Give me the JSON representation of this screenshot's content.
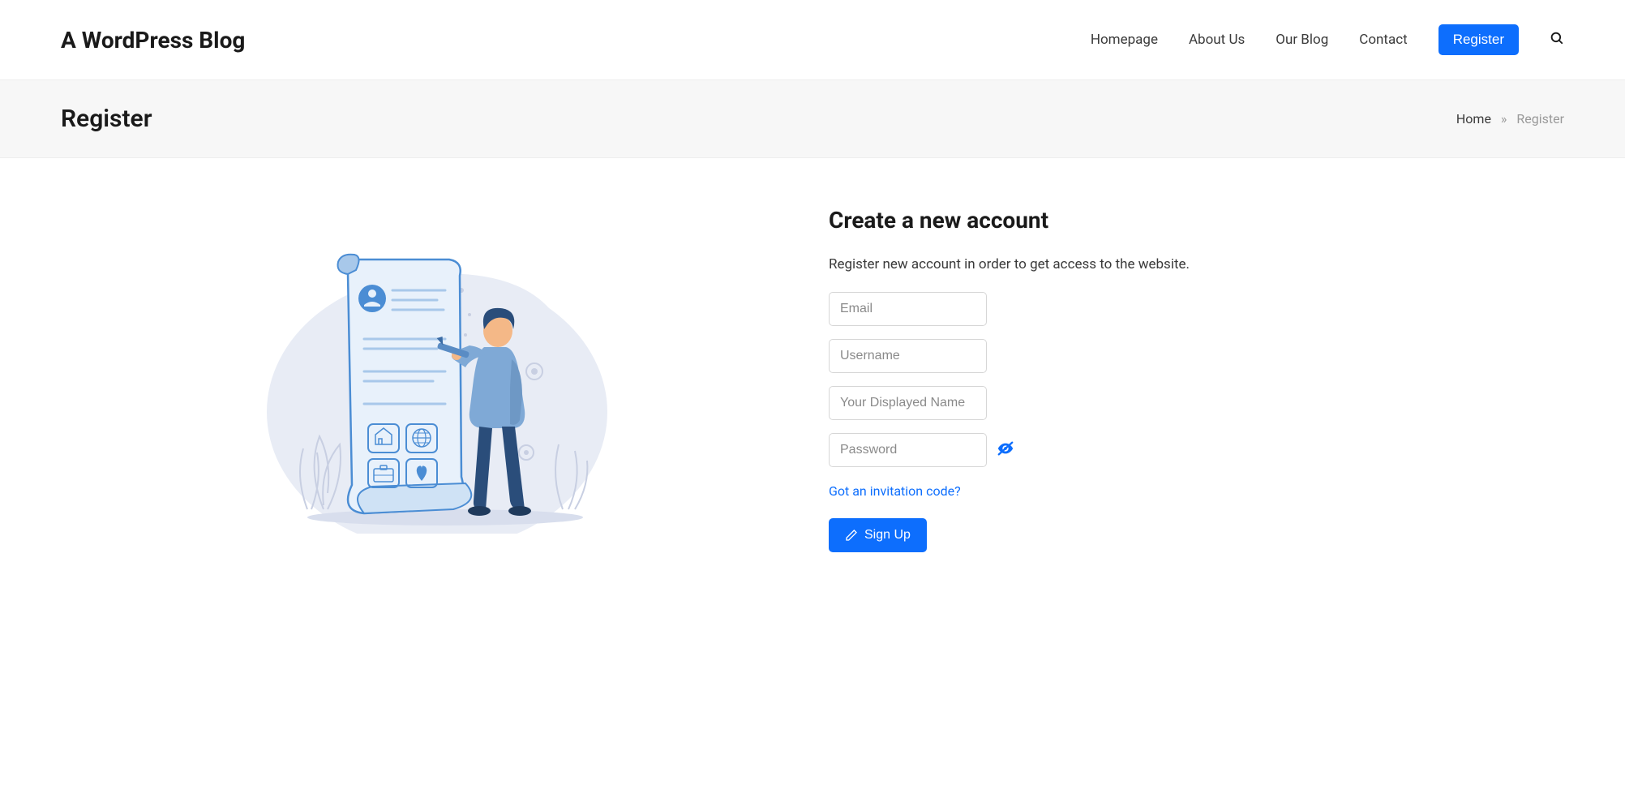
{
  "header": {
    "site_title": "A WordPress Blog",
    "nav": {
      "homepage": "Homepage",
      "about": "About Us",
      "blog": "Our Blog",
      "contact": "Contact",
      "register": "Register"
    }
  },
  "title_bar": {
    "page_title": "Register",
    "breadcrumb_home": "Home",
    "breadcrumb_sep": "»",
    "breadcrumb_current": "Register"
  },
  "form": {
    "heading": "Create a new account",
    "description": "Register new account in order to get access to the website.",
    "email_placeholder": "Email",
    "username_placeholder": "Username",
    "displayname_placeholder": "Your Displayed Name",
    "password_placeholder": "Password",
    "invitation_link": "Got an invitation code?",
    "submit_label": "Sign Up"
  }
}
